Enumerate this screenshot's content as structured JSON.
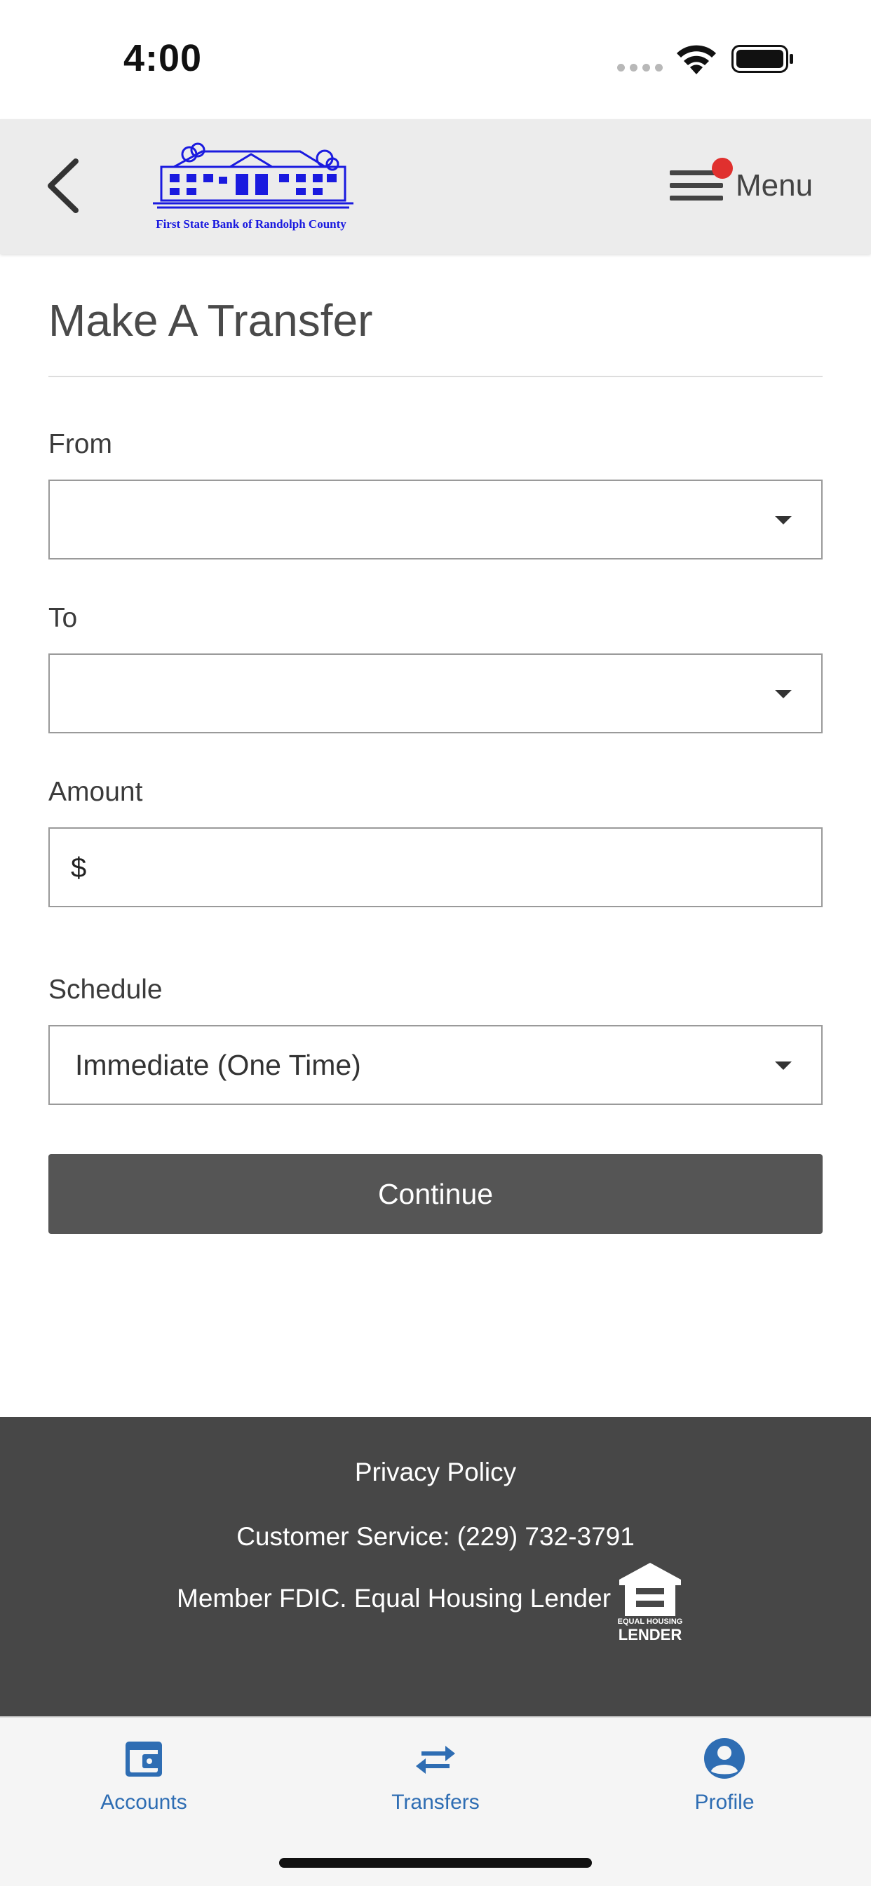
{
  "status_bar": {
    "time": "4:00"
  },
  "header": {
    "bank_name": "First State Bank of Randolph County",
    "menu_label": "Menu",
    "menu_notification": true
  },
  "transfer_form": {
    "title": "Make A Transfer",
    "from": {
      "label": "From",
      "value": ""
    },
    "to": {
      "label": "To",
      "value": ""
    },
    "amount": {
      "label": "Amount",
      "currency_symbol": "$",
      "value": ""
    },
    "schedule": {
      "label": "Schedule",
      "value": "Immediate (One Time)"
    },
    "continue_label": "Continue"
  },
  "footer": {
    "privacy_link": "Privacy Policy",
    "customer_service": "Customer Service: (229) 732-3791",
    "fdic_text": "Member FDIC. Equal Housing Lender",
    "ehl_logo_small": "EQUAL HOUSING",
    "ehl_logo_big": "LENDER"
  },
  "tab_bar": {
    "tabs": [
      {
        "label": "Accounts",
        "icon": "wallet-icon"
      },
      {
        "label": "Transfers",
        "icon": "transfer-arrows-icon"
      },
      {
        "label": "Profile",
        "icon": "profile-icon"
      }
    ]
  },
  "colors": {
    "header_bg": "#ececec",
    "footer_bg": "#474747",
    "button_bg": "#555555",
    "tab_accent": "#2e6db3",
    "logo_blue": "#1a1adf",
    "notification": "#e0302e"
  }
}
